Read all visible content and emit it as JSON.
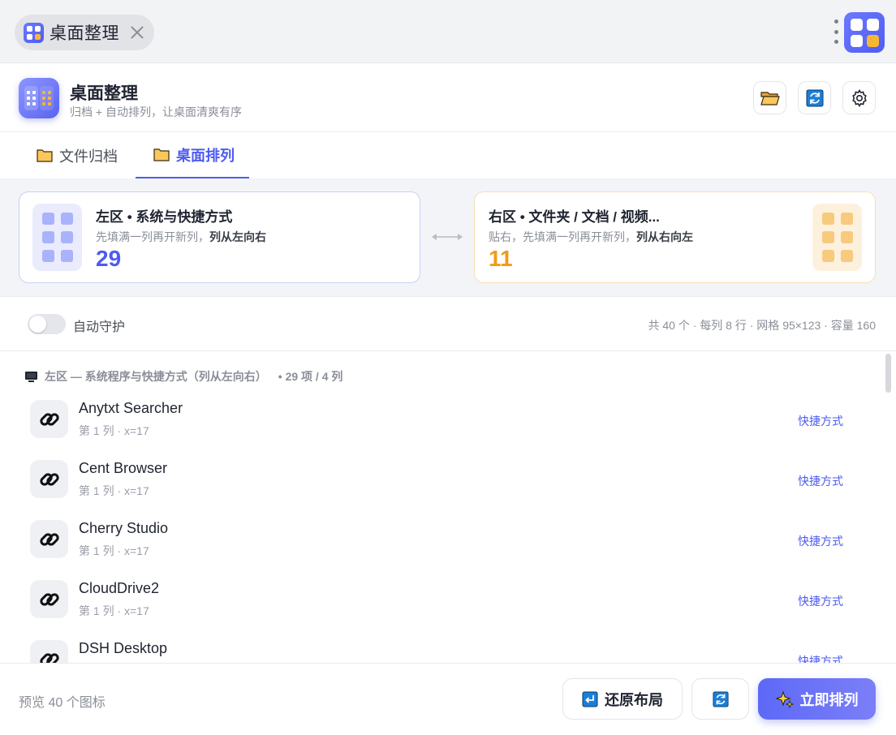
{
  "titlebar": {
    "tab_title": "桌面整理"
  },
  "header": {
    "title": "桌面整理",
    "subtitle": "归档 + 自动排列，让桌面清爽有序"
  },
  "tabs": [
    {
      "label": "文件归档",
      "active": false
    },
    {
      "label": "桌面排列",
      "active": true
    }
  ],
  "zones": {
    "left": {
      "title": "左区 • 系统与快捷方式",
      "desc_prefix": "先填满一列再开新列，",
      "desc_strong": "列从左向右",
      "count": "29"
    },
    "right": {
      "title": "右区 • 文件夹 / 文档 / 视频...",
      "desc_prefix": "贴右，先填满一列再开新列，",
      "desc_strong": "列从右向左",
      "count": "11"
    }
  },
  "options": {
    "auto_guard_label": "自动守护",
    "auto_guard_on": false,
    "stats": "共 40 个 · 每列 8 行 · 网格 95×123 · 容量 160"
  },
  "list": {
    "group_title": "左区 — 系统程序与快捷方式（列从左向右）",
    "group_meta": "• 29 项 / 4 列",
    "items": [
      {
        "name": "Anytxt Searcher",
        "meta": "第 1 列 · x=17",
        "type": "快捷方式"
      },
      {
        "name": "Cent Browser",
        "meta": "第 1 列 · x=17",
        "type": "快捷方式"
      },
      {
        "name": "Cherry Studio",
        "meta": "第 1 列 · x=17",
        "type": "快捷方式"
      },
      {
        "name": "CloudDrive2",
        "meta": "第 1 列 · x=17",
        "type": "快捷方式"
      },
      {
        "name": "DSH Desktop",
        "meta": "",
        "type": "快捷方式"
      }
    ]
  },
  "footer": {
    "preview": "预览 40 个图标",
    "restore_label": "还原布局",
    "arrange_label": "立即排列"
  },
  "colors": {
    "accent": "#4e5bf1",
    "orange": "#f29b16"
  },
  "icons": {
    "item_icon": "link-icon",
    "folder": "folder-icon",
    "refresh": "refresh-icon",
    "settings": "gear-icon",
    "sparkle": "sparkle-icon"
  }
}
